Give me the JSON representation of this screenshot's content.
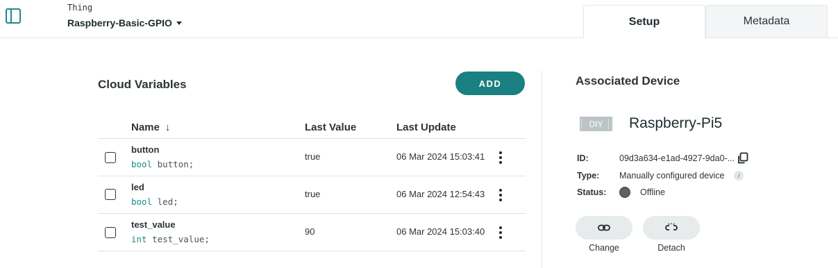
{
  "header": {
    "thing_label": "Thing",
    "thing_name": "Raspberry-Basic-GPIO",
    "tabs": [
      {
        "label": "Setup",
        "active": true
      },
      {
        "label": "Metadata",
        "active": false
      }
    ]
  },
  "cloud_variables": {
    "title": "Cloud Variables",
    "add_label": "ADD",
    "columns": {
      "name": "Name",
      "last_value": "Last Value",
      "last_update": "Last Update"
    },
    "rows": [
      {
        "name": "button",
        "type": "bool",
        "decl": "button;",
        "value": "true",
        "updated": "06 Mar 2024 15:03:41"
      },
      {
        "name": "led",
        "type": "bool",
        "decl": "led;",
        "value": "true",
        "updated": "06 Mar 2024 12:54:43"
      },
      {
        "name": "test_value",
        "type": "int",
        "decl": "test_value;",
        "value": "90",
        "updated": "06 Mar 2024 15:03:40"
      }
    ]
  },
  "device": {
    "title": "Associated Device",
    "badge": "DIY",
    "name": "Raspberry-Pi5",
    "id_label": "ID:",
    "id_value": "09d3a634-e1ad-4927-9da0-...",
    "type_label": "Type:",
    "type_value": "Manually configured device",
    "status_label": "Status:",
    "status_value": "Offline",
    "change_label": "Change",
    "detach_label": "Detach"
  },
  "colors": {
    "accent": "#1a8081",
    "status_offline": "#5c6366"
  }
}
